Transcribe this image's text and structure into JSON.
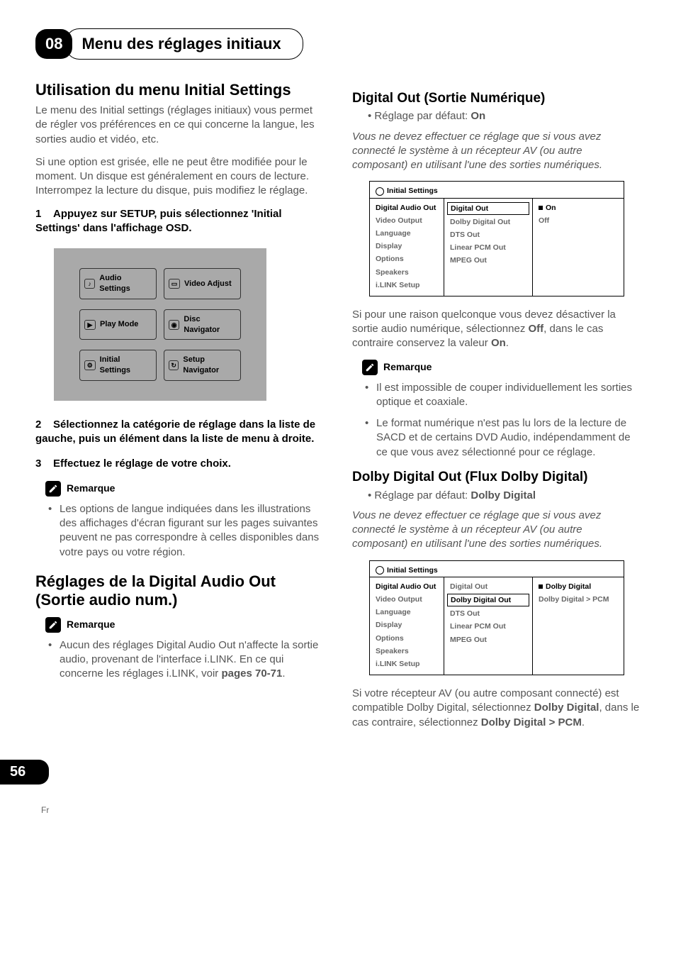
{
  "header": {
    "chapter_number": "08",
    "chapter_title": "Menu des réglages initiaux"
  },
  "left": {
    "h1": "Utilisation du menu Initial Settings",
    "p1": "Le menu des Initial settings (réglages initiaux) vous permet de régler vos préférences en ce qui concerne la langue, les sorties audio et vidéo, etc.",
    "p2": "Si une option est grisée, elle ne peut être modifiée pour le moment. Un disque est généralement en cours de lecture. Interrompez la lecture du disque, puis modifiez le réglage.",
    "step1_num": "1",
    "step1_txt": "Appuyez sur SETUP, puis sélectionnez 'Initial Settings' dans l'affichage OSD.",
    "osd": {
      "audio_settings": "Audio Settings",
      "video_adjust": "Video Adjust",
      "play_mode": "Play Mode",
      "disc_navigator": "Disc Navigator",
      "initial_settings": "Initial Settings",
      "setup_navigator": "Setup Navigator"
    },
    "step2_num": "2",
    "step2_txt": "Sélectionnez la catégorie de réglage dans la liste de gauche, puis un élément dans la liste de menu à droite.",
    "step3_num": "3",
    "step3_txt": "Effectuez le réglage de votre choix.",
    "note1_label": "Remarque",
    "note1_bullet": "Les options de langue indiquées dans les illustrations des affichages d'écran figurant sur les pages suivantes peuvent ne pas correspondre à celles disponibles dans votre pays ou votre région.",
    "h1b": "Réglages de la Digital Audio Out (Sortie audio num.)",
    "note2_label": "Remarque",
    "note2_bullet_pre": "Aucun des réglages Digital Audio Out n'affecte la sortie audio, provenant de l'interface i.LINK. En ce qui concerne les réglages i.LINK, voir ",
    "note2_bullet_bold": "pages 70-71",
    "note2_bullet_post": "."
  },
  "right": {
    "h2a": "Digital Out (Sortie Numérique)",
    "default_a_pre": "Réglage par défaut: ",
    "default_a_val": "On",
    "italic_a": "Vous ne devez effectuer ce réglage que si vous avez connecté le système à un récepteur AV (ou autre composant) en utilisant l'une des sorties numériques.",
    "panel_a": {
      "title": "Initial Settings",
      "left_items": [
        "Digital Audio Out",
        "Video Output",
        "Language",
        "Display",
        "Options",
        "Speakers",
        "i.LINK Setup"
      ],
      "mid_items": [
        "Digital Out",
        "Dolby Digital Out",
        "DTS Out",
        "Linear PCM Out",
        "MPEG Out"
      ],
      "right_items": [
        "On",
        "Off"
      ],
      "left_active": 0,
      "mid_highlight": 0,
      "right_active": 0
    },
    "p_after_a_1": "Si pour une raison quelconque vous devez désactiver la sortie audio numérique, sélectionnez ",
    "p_after_a_b1": "Off",
    "p_after_a_2": ", dans le cas contraire conservez la valeur ",
    "p_after_a_b2": "On",
    "p_after_a_3": ".",
    "noteA_label": "Remarque",
    "noteA_b1": "Il est impossible de couper individuellement les sorties optique et coaxiale.",
    "noteA_b2": "Le format numérique n'est pas lu lors de la lecture de SACD et de certains DVD Audio, indépendamment de ce que vous avez sélectionné pour ce réglage.",
    "h2b": "Dolby Digital Out (Flux Dolby Digital)",
    "default_b_pre": "Réglage par défaut: ",
    "default_b_val": "Dolby Digital",
    "italic_b": "Vous ne devez effectuer ce réglage que si vous avez connecté le système à un récepteur AV (ou autre composant) en utilisant l'une des sorties numériques.",
    "panel_b": {
      "title": "Initial Settings",
      "left_items": [
        "Digital Audio Out",
        "Video Output",
        "Language",
        "Display",
        "Options",
        "Speakers",
        "i.LINK Setup"
      ],
      "mid_items": [
        "Digital Out",
        "Dolby Digital Out",
        "DTS Out",
        "Linear PCM Out",
        "MPEG Out"
      ],
      "right_items": [
        "Dolby Digital",
        "Dolby Digital > PCM"
      ],
      "left_active": 0,
      "mid_highlight": 1,
      "right_active": 0
    },
    "p_after_b_1": "Si votre récepteur AV (ou autre composant connecté) est compatible Dolby Digital, sélectionnez ",
    "p_after_b_b1": "Dolby Digital",
    "p_after_b_2": ", dans le cas contraire, sélectionnez ",
    "p_after_b_b2": "Dolby Digital > PCM",
    "p_after_b_3": "."
  },
  "footer": {
    "page_number": "56",
    "lang": "Fr"
  }
}
